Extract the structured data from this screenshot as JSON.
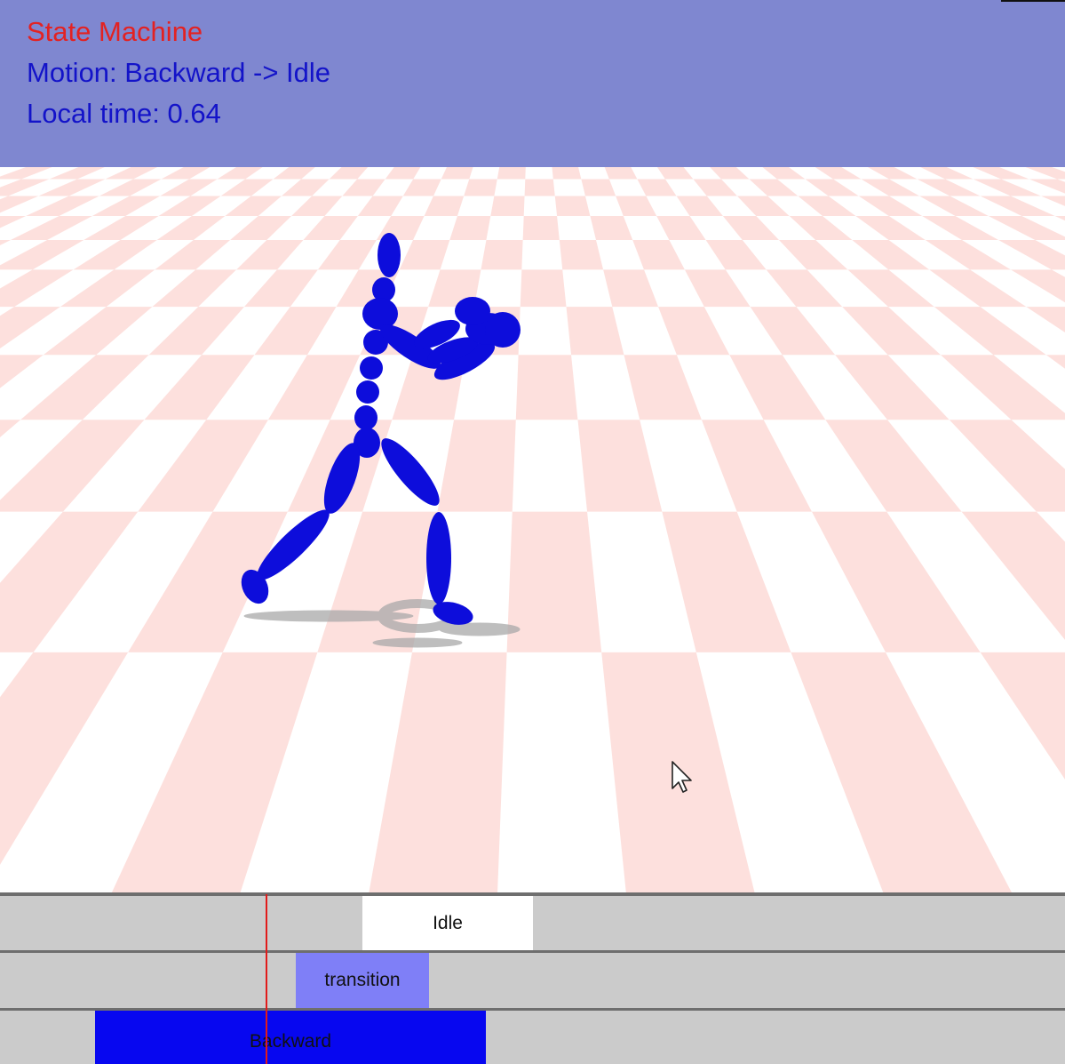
{
  "overlay": {
    "title": "State Machine",
    "motion": "Motion: Backward -> Idle",
    "local_time": "Local time: 0.64"
  },
  "colors": {
    "header_bg": "#7f87d0",
    "title_text": "#e32222",
    "info_text": "#1313c9",
    "floor_pink": "#fde0dd",
    "floor_white": "#ffffff",
    "character": "#0d0ddb",
    "shadow": "#a9a9a9",
    "playhead": "#e11b1b"
  },
  "timeline": {
    "tracks": [
      {
        "name": "idle-track",
        "clip_label": "Idle",
        "clip_color": "#ffffff"
      },
      {
        "name": "transition-track",
        "clip_label": "transition",
        "clip_color": "#7f7ff7"
      },
      {
        "name": "backward-track",
        "clip_label": "Backward",
        "clip_color": "#0707f0"
      }
    ]
  },
  "cursor_icon": "arrow-pointer-icon"
}
